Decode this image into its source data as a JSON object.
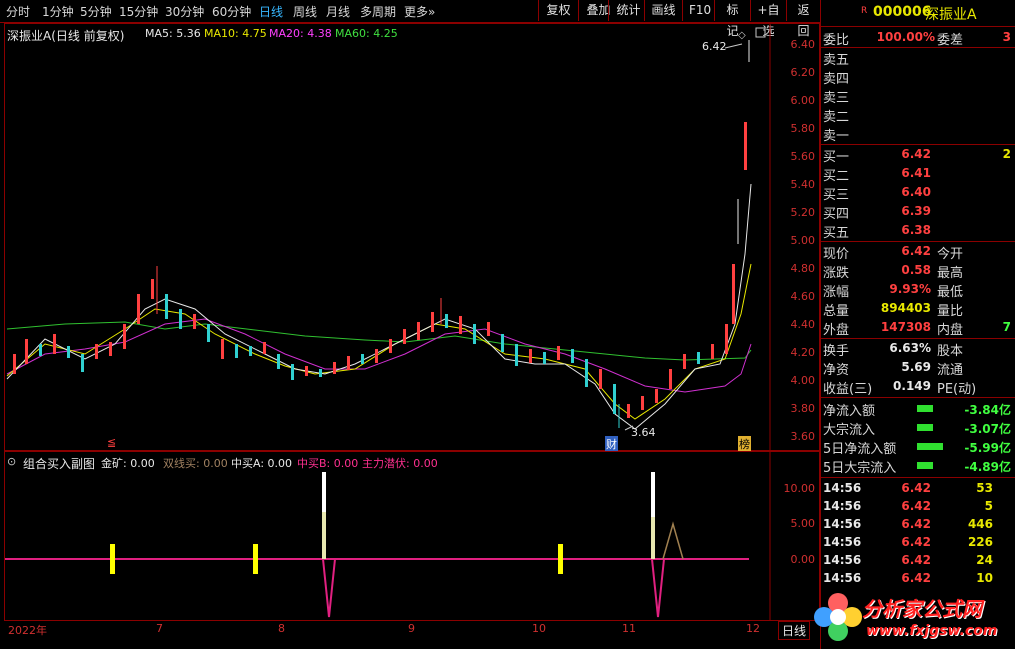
{
  "toolbar": {
    "periods": [
      "分时",
      "1分钟",
      "5分钟",
      "15分钟",
      "30分钟",
      "60分钟",
      "日线",
      "周线",
      "月线",
      "多周期",
      "更多»"
    ],
    "active_period": "日线",
    "tools": [
      "复权",
      "叠加",
      "统计",
      "画线",
      "F10",
      "标记",
      "+自选",
      "返回"
    ]
  },
  "main_chart": {
    "title": "深振业A(日线 前复权)",
    "ma": [
      {
        "label": "MA5: 5.36",
        "color": "#e8e8e8"
      },
      {
        "label": "MA10: 4.75",
        "color": "#e8e800"
      },
      {
        "label": "MA20: 4.38",
        "color": "#ff40ff"
      },
      {
        "label": "MA60: 4.25",
        "color": "#40e040"
      }
    ],
    "y_ticks": [
      "6.40",
      "6.20",
      "6.00",
      "5.80",
      "5.60",
      "5.40",
      "5.20",
      "5.00",
      "4.80",
      "4.60",
      "4.40",
      "4.20",
      "4.00",
      "3.80",
      "3.60"
    ],
    "high_label": "6.42",
    "low_label": "3.64",
    "marker_cai": "财",
    "marker_bang": "榜",
    "marker_left": "≦"
  },
  "sub_chart": {
    "title": "组合买入副图",
    "indicators": [
      {
        "label": "金矿: 0.00",
        "color": "#e8e8e8"
      },
      {
        "label": "双线买: 0.00",
        "color": "#a08060"
      },
      {
        "label": "中买A: 0.00",
        "color": "#e8e8e8"
      },
      {
        "label": "中买B: 0.00",
        "color": "#ff3090"
      },
      {
        "label": "主力潜伏: 0.00",
        "color": "#ff3090"
      }
    ],
    "y_ticks": [
      "10.00",
      "5.00",
      "0.00"
    ]
  },
  "date_axis": {
    "labels": [
      "2022年",
      "7",
      "8",
      "9",
      "10",
      "11",
      "12"
    ],
    "period_label": "日线"
  },
  "quote": {
    "code": "000006",
    "name": "深振业A",
    "r_mark": "R",
    "weibi_label": "委比",
    "weibi_value": "100.00%",
    "weicha_label": "委差",
    "weicha_value": "3",
    "sell": [
      {
        "label": "卖五"
      },
      {
        "label": "卖四"
      },
      {
        "label": "卖三"
      },
      {
        "label": "卖二"
      },
      {
        "label": "卖一"
      }
    ],
    "buy": [
      {
        "label": "买一",
        "price": "6.42",
        "vol": "2"
      },
      {
        "label": "买二",
        "price": "6.41",
        "vol": ""
      },
      {
        "label": "买三",
        "price": "6.40",
        "vol": ""
      },
      {
        "label": "买四",
        "price": "6.39",
        "vol": ""
      },
      {
        "label": "买五",
        "price": "6.38",
        "vol": ""
      }
    ],
    "stats": [
      {
        "l1": "现价",
        "v1": "6.42",
        "c1": "#ff4040",
        "l2": "今开",
        "v2": ""
      },
      {
        "l1": "涨跌",
        "v1": "0.58",
        "c1": "#ff4040",
        "l2": "最高",
        "v2": ""
      },
      {
        "l1": "涨幅",
        "v1": "9.93%",
        "c1": "#ff4040",
        "l2": "最低",
        "v2": ""
      },
      {
        "l1": "总量",
        "v1": "894403",
        "c1": "#e8e800",
        "l2": "量比",
        "v2": ""
      },
      {
        "l1": "外盘",
        "v1": "147308",
        "c1": "#ff4040",
        "l2": "内盘",
        "v2": "7"
      }
    ],
    "fin": [
      {
        "l1": "换手",
        "v1": "6.63%",
        "l2": "股本",
        "v2": ""
      },
      {
        "l1": "净资",
        "v1": "5.69",
        "l2": "流通",
        "v2": ""
      },
      {
        "l1": "收益(三)",
        "v1": "0.149",
        "l2": "PE(动)",
        "v2": ""
      }
    ],
    "flows": [
      {
        "label": "净流入额",
        "value": "-3.84亿",
        "bar": 16
      },
      {
        "label": "大宗流入",
        "value": "-3.07亿",
        "bar": 16
      },
      {
        "label": "5日净流入额",
        "value": "-5.99亿",
        "bar": 26
      },
      {
        "label": "5日大宗流入",
        "value": "-4.89亿",
        "bar": 16
      }
    ],
    "ticks": [
      {
        "time": "14:56",
        "price": "6.42",
        "vol": "53"
      },
      {
        "time": "14:56",
        "price": "6.42",
        "vol": "5"
      },
      {
        "time": "14:56",
        "price": "6.42",
        "vol": "446"
      },
      {
        "time": "14:56",
        "price": "6.42",
        "vol": "226"
      },
      {
        "time": "14:56",
        "price": "6.42",
        "vol": "24"
      },
      {
        "time": "14:56",
        "price": "6.42",
        "vol": "10"
      }
    ]
  },
  "watermark": {
    "brand": "分析家公式网",
    "url": "www.fxjgsw.com"
  }
}
